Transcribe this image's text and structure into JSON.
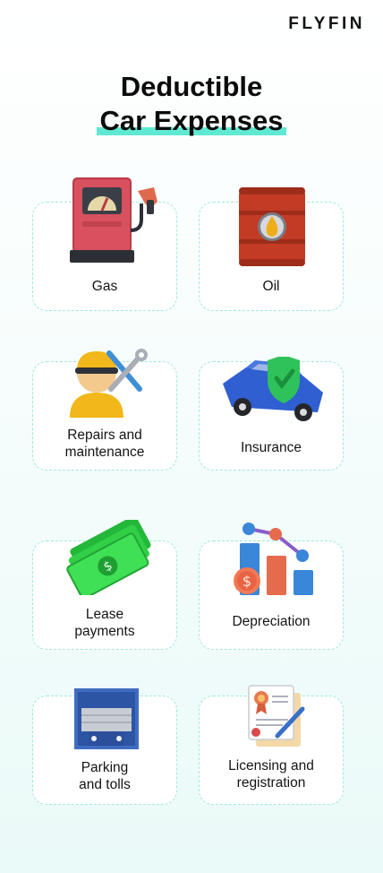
{
  "brand": "FLYFIN",
  "title": {
    "line1": "Deductible",
    "line2": "Car Expenses"
  },
  "cards": [
    {
      "label": "Gas",
      "icon": "fuel-pump-icon"
    },
    {
      "label": "Oil",
      "icon": "oil-barrel-icon"
    },
    {
      "label": "Repairs and\nmaintenance",
      "icon": "mechanic-wrench-icon"
    },
    {
      "label": "Insurance",
      "icon": "car-shield-icon"
    },
    {
      "label": "Lease\npayments",
      "icon": "money-bills-icon"
    },
    {
      "label": "Depreciation",
      "icon": "declining-chart-icon"
    },
    {
      "label": "Parking\nand tolls",
      "icon": "parking-garage-icon"
    },
    {
      "label": "Licensing and\nregistration",
      "icon": "certificate-document-icon"
    }
  ]
}
